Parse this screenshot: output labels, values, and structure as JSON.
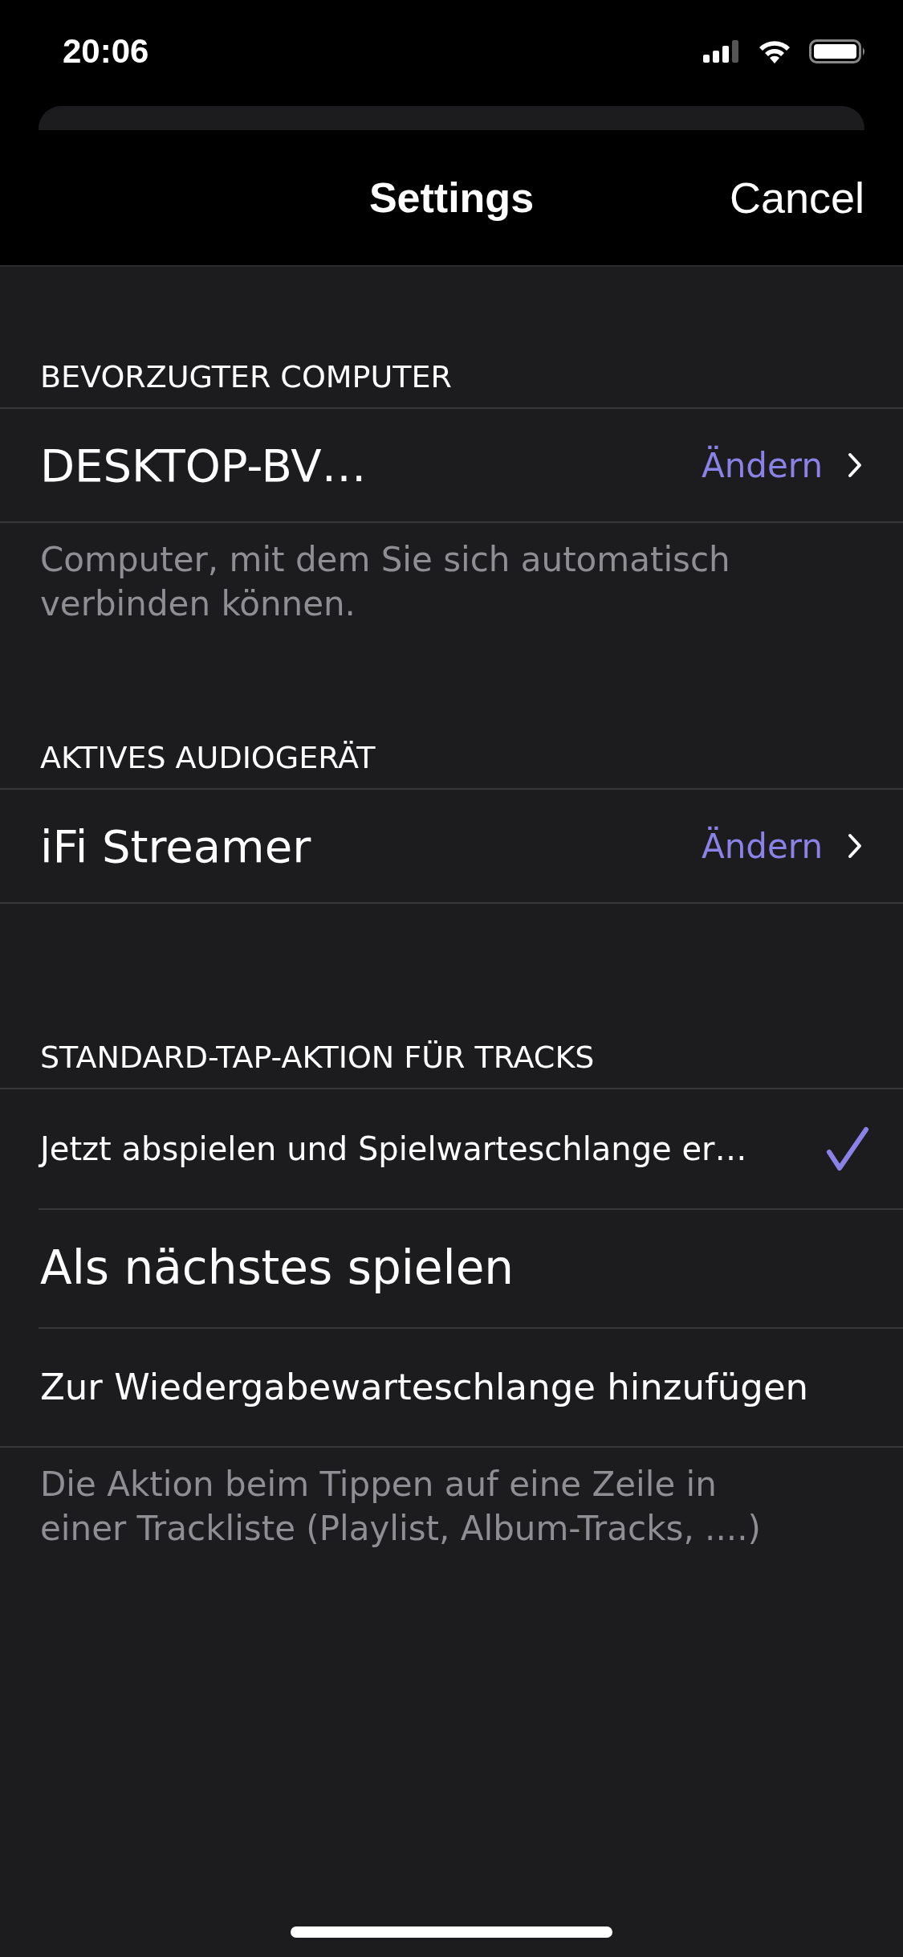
{
  "status_bar": {
    "time": "20:06"
  },
  "nav": {
    "title": "Settings",
    "cancel": "Cancel"
  },
  "sections": [
    {
      "header": "BEVORZUGTER COMPUTER",
      "kind": "value",
      "rows": [
        {
          "label": "DESKTOP-BV…",
          "action": "Ändern"
        }
      ],
      "footer": "Computer, mit dem Sie sich automatisch verbinden können."
    },
    {
      "header": "AKTIVES AUDIOGERÄT",
      "kind": "value",
      "rows": [
        {
          "label": "iFi Streamer",
          "action": "Ändern"
        }
      ]
    },
    {
      "header": "STANDARD-TAP-AKTION FÜR TRACKS",
      "kind": "choice",
      "rows": [
        {
          "label": "Jetzt abspielen und Spielwarteschlange er…",
          "selected": true
        },
        {
          "label": "Als nächstes spielen",
          "selected": false
        },
        {
          "label": "Zur Wiedergabewarteschlange hinzufügen",
          "selected": false
        }
      ],
      "footer": "Die Aktion beim Tippen auf eine Zeile in einer Trackliste (Playlist, Album-Tracks, ....)"
    }
  ]
}
